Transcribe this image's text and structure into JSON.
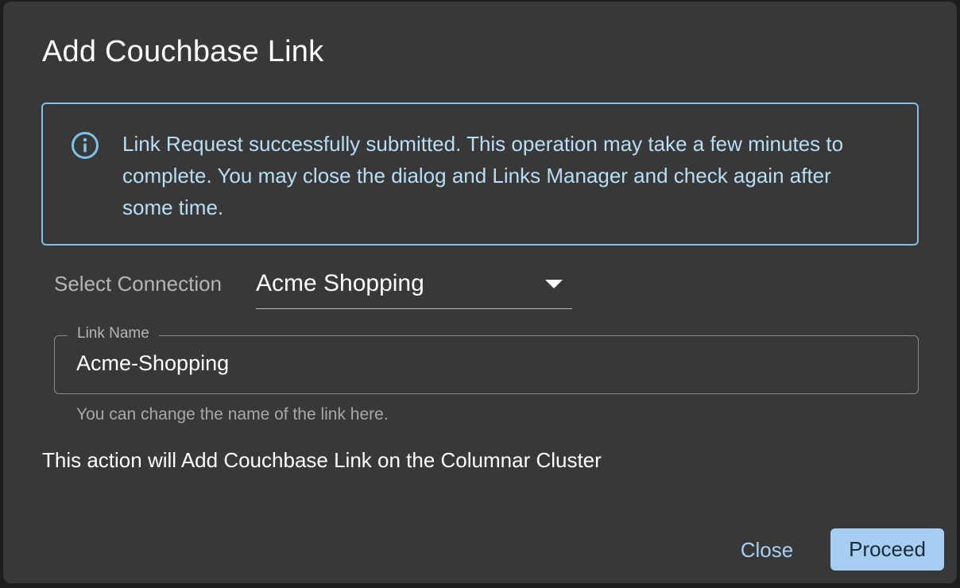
{
  "dialog": {
    "title": "Add Couchbase Link",
    "alert": {
      "icon": "info-icon",
      "message": "Link Request successfully submitted. This operation may take a few minutes to complete. You may close the dialog and Links Manager and check again after some time.",
      "color": "#7cc2ec"
    },
    "connection": {
      "label": "Select Connection",
      "selected": "Acme Shopping",
      "icon": "caret-down-icon"
    },
    "link_name": {
      "label": "Link Name",
      "value": "Acme-Shopping",
      "helper": "You can change the name of the link here."
    },
    "action_text": "This action will Add Couchbase Link on the Columnar Cluster",
    "buttons": {
      "close": "Close",
      "proceed": "Proceed"
    },
    "colors": {
      "background": "#383838",
      "primary": "#a6cef3"
    }
  }
}
